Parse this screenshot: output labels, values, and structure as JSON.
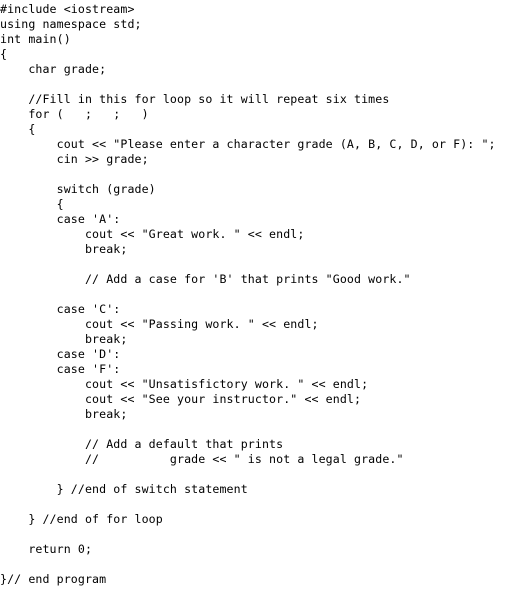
{
  "code": {
    "language": "cpp",
    "lines": [
      "#include <iostream>",
      "using namespace std;",
      "int main()",
      "{",
      "    char grade;",
      "",
      "    //Fill in this for loop so it will repeat six times",
      "    for (   ;   ;   )",
      "    {",
      "        cout << \"Please enter a character grade (A, B, C, D, or F): \";",
      "        cin >> grade;",
      "",
      "        switch (grade)",
      "        {",
      "        case 'A':",
      "            cout << \"Great work. \" << endl;",
      "            break;",
      "",
      "            // Add a case for 'B' that prints \"Good work.\"",
      "",
      "        case 'C':",
      "            cout << \"Passing work. \" << endl;",
      "            break;",
      "        case 'D':",
      "        case 'F':",
      "            cout << \"Unsatisfictory work. \" << endl;",
      "            cout << \"See your instructor.\" << endl;",
      "            break;",
      "",
      "            // Add a default that prints",
      "            //          grade << \" is not a legal grade.\"",
      "",
      "        } //end of switch statement",
      "",
      "    } //end of for loop",
      "",
      "    return 0;",
      "",
      "}// end program"
    ]
  }
}
